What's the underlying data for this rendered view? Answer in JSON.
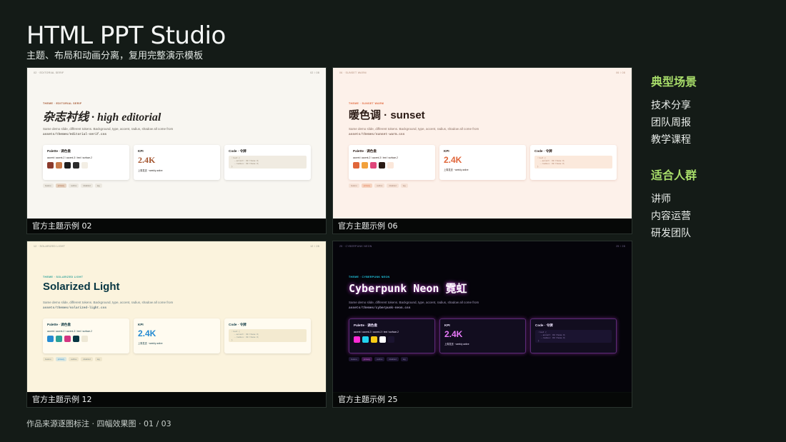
{
  "header": {
    "title": "HTML PPT Studio",
    "subtitle": "主题、布局和动画分离，复用完整演示模板"
  },
  "panels": [
    {
      "caption": "官方主题示例 02",
      "top_left": "02 · EDITORIAL SERIF",
      "top_right": "02 / 08",
      "tag": "THEME · EDITORIAL SERIF",
      "heading": "杂志衬线 · high editorial",
      "desc": "Same demo slide, different tokens. Background, type, accent, radius, shadow all come from",
      "desc_file": "assets/themes/editorial-serif.css",
      "palette_title": "Palette · 调色盘",
      "palette_sub": "accent / accent-2 / accent-3 / text / surface-2",
      "colors": [
        "#8b3a2c",
        "#c77a4a",
        "#1e1e1e",
        "#2b2b2b",
        "#f3eee4"
      ],
      "kpi_title": "KPI",
      "kpi": "2.4K",
      "kpi_sub": "上周发送 · weekly active",
      "code_title": "Code · 令牌",
      "code": ":root {\n  --accent: #0 theme #;\n  --radius: #0 theme #;\n}",
      "pills": [
        "feature",
        "primary",
        "outline",
        "disabled",
        "tag"
      ]
    },
    {
      "caption": "官方主题示例 06",
      "top_left": "06 · SUNSET WARM",
      "top_right": "06 / 08",
      "tag": "THEME · SUNSET WARM",
      "heading": "暖色调 · sunset",
      "desc": "Same demo slide, different tokens. Background, type, accent, radius, shadow all come from",
      "desc_file": "assets/themes/sunset-warm.css",
      "palette_title": "Palette · 调色盘",
      "palette_sub": "accent / accent-2 / accent-3 / text / surface-2",
      "colors": [
        "#e0663a",
        "#f2a13c",
        "#e0457a",
        "#2a1a14",
        "#fbe7da"
      ],
      "kpi_title": "KPI",
      "kpi": "2.4K",
      "kpi_sub": "上周发送 · weekly active",
      "code_title": "Code · 令牌",
      "code": ":root {\n  --accent: #0 theme #;\n  --radius: #0 theme #;\n}",
      "pills": [
        "feature",
        "primary",
        "outline",
        "disabled",
        "tag"
      ]
    },
    {
      "caption": "官方主题示例 12",
      "top_left": "12 · SOLARIZED LIGHT",
      "top_right": "12 / 28",
      "tag": "THEME · SOLARIZED LIGHT",
      "heading": "Solarized Light",
      "desc": "Same demo slide, different tokens. Background, type, accent, radius, shadow all come from",
      "desc_file": "assets/themes/solarized-light.css",
      "palette_title": "Palette · 调色盘",
      "palette_sub": "accent / accent-2 / accent-3 / text / surface-2",
      "colors": [
        "#268bd2",
        "#2aa198",
        "#d33682",
        "#073642",
        "#eee8d5"
      ],
      "kpi_title": "KPI",
      "kpi": "2.4K",
      "kpi_sub": "上周发送 · weekly active",
      "code_title": "Code · 令牌",
      "code": ":root {\n  --accent: #0 theme #;\n  --radius: #0 theme #;\n}",
      "pills": [
        "feature",
        "primary",
        "outline",
        "disabled",
        "tag"
      ]
    },
    {
      "caption": "官方主题示例 25",
      "top_left": "25 · CYBERPUNK NEON",
      "top_right": "25 / 28",
      "tag": "THEME · CYBERPUNK NEON",
      "heading": "Cyberpunk Neon 霓虹",
      "desc": "Same demo slide, different tokens. Background, type, accent, radius, shadow all come from",
      "desc_file": "assets/themes/cyberpunk-neon.css",
      "palette_title": "Palette · 调色盘",
      "palette_sub": "accent / accent-2 / accent-3 / text / surface-2",
      "colors": [
        "#ff2bd6",
        "#22d3ee",
        "#facc15",
        "#ffffff",
        "#1b1430"
      ],
      "kpi_title": "KPI",
      "kpi": "2.4K",
      "kpi_sub": "上周发送 · weekly active",
      "code_title": "Code · 令牌",
      "code": ":root {\n  --accent: #0 theme #;\n  --radius: #0 theme #;\n}",
      "pills": [
        "feature",
        "primary",
        "outline",
        "disabled",
        "tag"
      ]
    }
  ],
  "sidebar": {
    "scenarios_title": "典型场景",
    "scenarios": [
      "技术分享",
      "团队周报",
      "教学课程"
    ],
    "audience_title": "适合人群",
    "audience": [
      "讲师",
      "内容运营",
      "研发团队"
    ]
  },
  "footer": "作品来源逐图标注 · 四幅效果图 · 01 / 03",
  "colors": {
    "background": "#141b17",
    "accent_green": "#a8dd6a"
  }
}
